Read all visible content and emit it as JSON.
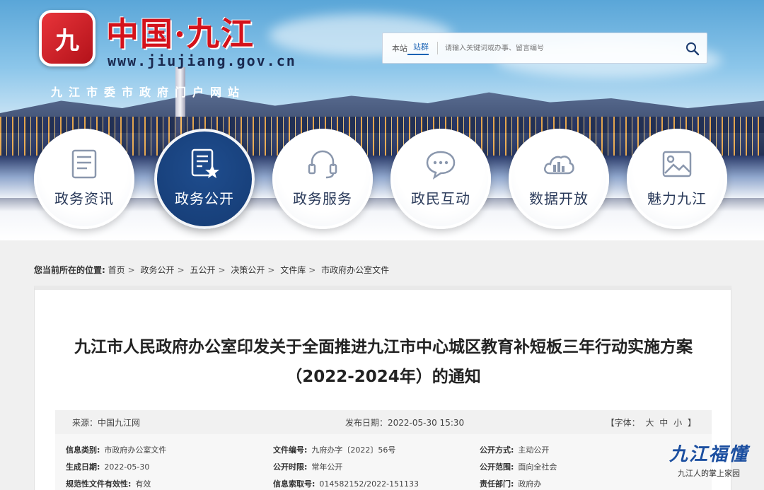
{
  "header": {
    "logo_glyph": "九",
    "site_name": "中国·九江",
    "site_url": "www.jiujiang.gov.cn",
    "site_subtitle": "九江市委市政府门户网站"
  },
  "search": {
    "scope_local": "本站",
    "scope_group": "站群",
    "placeholder": "请输入关键词或办事、留言编号"
  },
  "nav": {
    "items": [
      {
        "label": "政务资讯",
        "icon": "document-icon"
      },
      {
        "label": "政务公开",
        "icon": "doc-star-icon"
      },
      {
        "label": "政务服务",
        "icon": "headset-icon"
      },
      {
        "label": "政民互动",
        "icon": "chat-icon"
      },
      {
        "label": "数据开放",
        "icon": "cloud-chart-icon"
      },
      {
        "label": "魅力九江",
        "icon": "image-icon"
      }
    ],
    "active_index": 1
  },
  "breadcrumb": {
    "prefix": "您当前所在的位置:",
    "items": [
      "首页",
      "政务公开",
      "五公开",
      "决策公开",
      "文件库",
      "市政府办公室文件"
    ]
  },
  "article": {
    "title": "九江市人民政府办公室印发关于全面推进九江市中心城区教育补短板三年行动实施方案（2022-2024年）的通知",
    "source": "来源：中国九江网",
    "publish_date": "发布日期：2022-05-30 15:30",
    "font_label": "【字体：",
    "font_large": "大",
    "font_medium": "中",
    "font_small": "小",
    "font_close": "】"
  },
  "info": {
    "category_label": "信息类别:",
    "category_value": "市政府办公室文件",
    "docno_label": "文件编号:",
    "docno_value": "九府办字〔2022〕56号",
    "mode_label": "公开方式:",
    "mode_value": "主动公开",
    "date_label": "生成日期:",
    "date_value": "2022-05-30",
    "period_label": "公开时限:",
    "period_value": "常年公开",
    "scope_label": "公开范围:",
    "scope_value": "面向全社会",
    "valid_label": "规范性文件有效性:",
    "valid_value": "有效",
    "index_label": "信息索取号:",
    "index_value": "014582152/2022-151133",
    "dept_label": "责任部门:",
    "dept_value": "政府办"
  },
  "watermark": {
    "logo_text": "九江福懂",
    "subtitle": "九江人的掌上家园"
  },
  "colors": {
    "brand_red": "#d4121b",
    "nav_active": "#143a72",
    "link_blue": "#1a63b4"
  }
}
